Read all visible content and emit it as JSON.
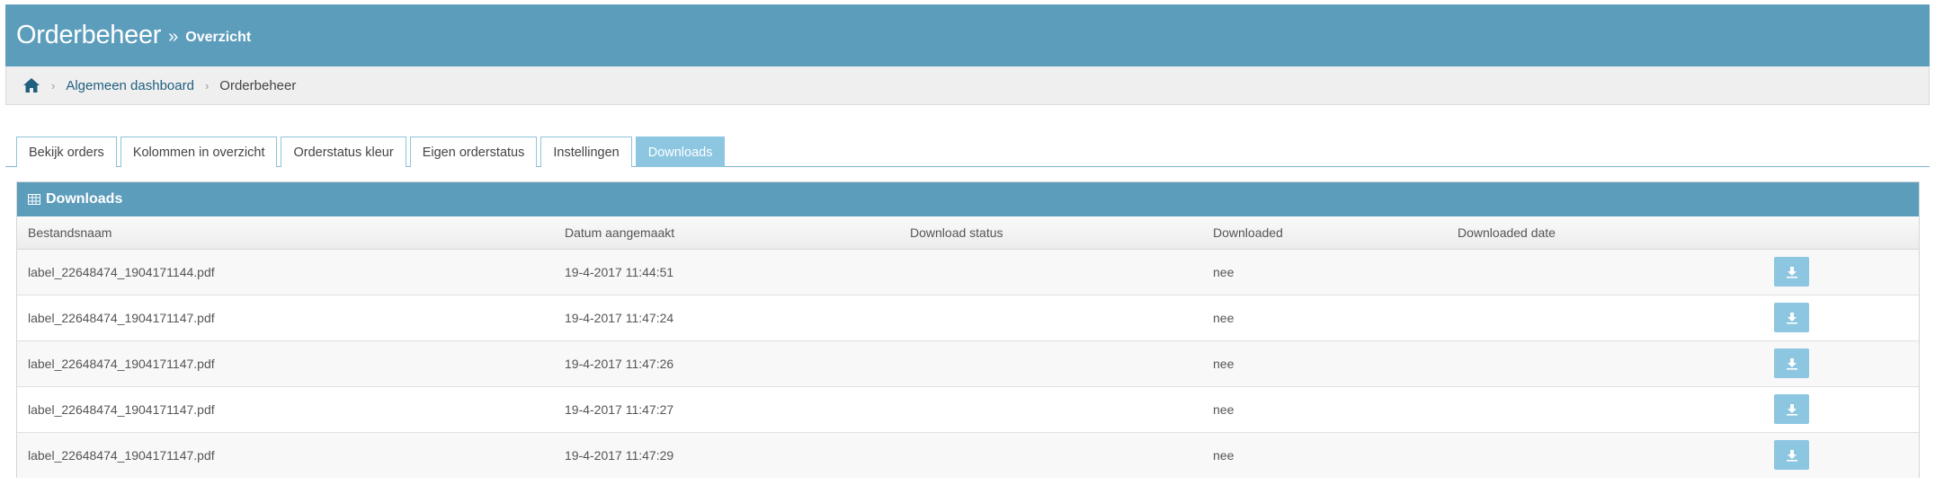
{
  "header": {
    "title": "Orderbeheer",
    "separator": "»",
    "subtitle": "Overzicht"
  },
  "breadcrumb": {
    "home_icon": "home-icon",
    "items": [
      "Algemeen dashboard",
      "Orderbeheer"
    ]
  },
  "tabs": [
    {
      "label": "Bekijk orders",
      "active": false
    },
    {
      "label": "Kolommen in overzicht",
      "active": false
    },
    {
      "label": "Orderstatus kleur",
      "active": false
    },
    {
      "label": "Eigen orderstatus",
      "active": false
    },
    {
      "label": "Instellingen",
      "active": false
    },
    {
      "label": "Downloads",
      "active": true
    }
  ],
  "panel": {
    "title": "Downloads",
    "icon": "table-icon",
    "columns": [
      "Bestandsnaam",
      "Datum aangemaakt",
      "Download status",
      "Downloaded",
      "Downloaded date",
      ""
    ],
    "rows": [
      {
        "filename": "label_22648474_1904171144.pdf",
        "created": "19-4-2017 11:44:51",
        "status": "",
        "downloaded": "nee",
        "downloaded_date": ""
      },
      {
        "filename": "label_22648474_1904171147.pdf",
        "created": "19-4-2017 11:47:24",
        "status": "",
        "downloaded": "nee",
        "downloaded_date": ""
      },
      {
        "filename": "label_22648474_1904171147.pdf",
        "created": "19-4-2017 11:47:26",
        "status": "",
        "downloaded": "nee",
        "downloaded_date": ""
      },
      {
        "filename": "label_22648474_1904171147.pdf",
        "created": "19-4-2017 11:47:27",
        "status": "",
        "downloaded": "nee",
        "downloaded_date": ""
      },
      {
        "filename": "label_22648474_1904171147.pdf",
        "created": "19-4-2017 11:47:29",
        "status": "",
        "downloaded": "nee",
        "downloaded_date": ""
      }
    ]
  },
  "colors": {
    "primary": "#5d9dbc",
    "accent": "#8cc6e1",
    "link": "#1f5f80"
  }
}
